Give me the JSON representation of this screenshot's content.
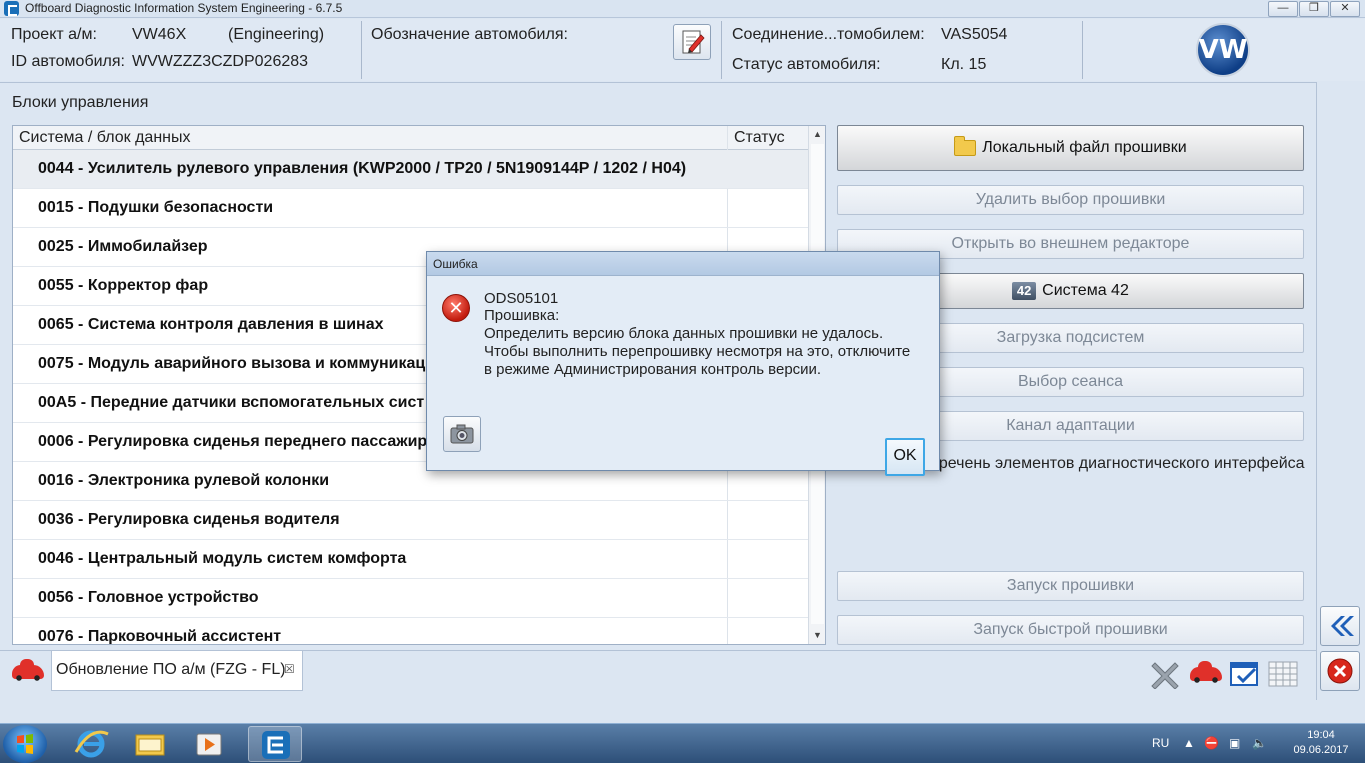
{
  "window": {
    "title": "Offboard Diagnostic Information System Engineering - 6.7.5"
  },
  "header": {
    "project_label": "Проект а/м:",
    "project_value": "VW46X",
    "project_mode": "(Engineering)",
    "vin_label": "ID автомобиля:",
    "vin_value": "WVWZZZ3CZDP026283",
    "designation_label": "Обозначение автомобиля:",
    "connection_label": "Соединение...томобилем:",
    "connection_value": "VAS5054",
    "status_label": "Статус автомобиля:",
    "status_value": "Кл. 15",
    "brand": "VW"
  },
  "main": {
    "section_title": "Блоки управления",
    "columns": [
      "Система / блок данных",
      "Статус"
    ],
    "rows": [
      "0044 - Усилитель рулевого управления  (KWP2000 / TP20 / 5N1909144P / 1202 / H04)",
      "0015 - Подушки безопасности",
      "0025 - Иммобилайзер",
      "0055 - Корректор фар",
      "0065 - Система контроля давления в шинах",
      "0075 - Модуль аварийного вызова и коммуникац",
      "00A5 - Передние датчики вспомогательных сист",
      "0006 - Регулировка сиденья переднего пассажир",
      "0016 - Электроника рулевой колонки",
      "0036 - Регулировка сиденья водителя",
      "0046 - Центральный модуль систем комфорта",
      "0056 - Головное устройство",
      "0076 - Парковочный ассистент"
    ]
  },
  "actions": {
    "local_file": "Локальный файл прошивки",
    "delete_selection": "Удалить выбор прошивки",
    "open_external": "Открыть во внешнем редакторе",
    "system42_icon_text": "42",
    "system42": "Система 42",
    "load_subsystems": "Загрузка подсистем",
    "select_session": "Выбор сеанса",
    "adaptation_channel": "Канал адаптации",
    "interface_list": "еречень элементов диагностического интерфейса",
    "start_flash": "Запуск прошивки",
    "start_quick_flash": "Запуск быстрой прошивки"
  },
  "tabs": [
    {
      "label": "Обновление ПО а/м (FZG - FL)",
      "close": "☒"
    }
  ],
  "dialog": {
    "title": "Ошибка",
    "code": "ODS05101",
    "line1": "Прошивка:",
    "line2": "Определить версию блока данных прошивки не удалось.",
    "line3": "Чтобы выполнить перепрошивку несмотря на это, отключите",
    "line4": "в режиме Администрирования контроль версии.",
    "ok": "OK"
  },
  "taskbar": {
    "lang": "RU",
    "time": "19:04",
    "date": "09.06.2017"
  },
  "colors": {
    "accent": "#1a6fb8",
    "error": "#c21b0e",
    "ok_border": "#3ea7e6"
  }
}
